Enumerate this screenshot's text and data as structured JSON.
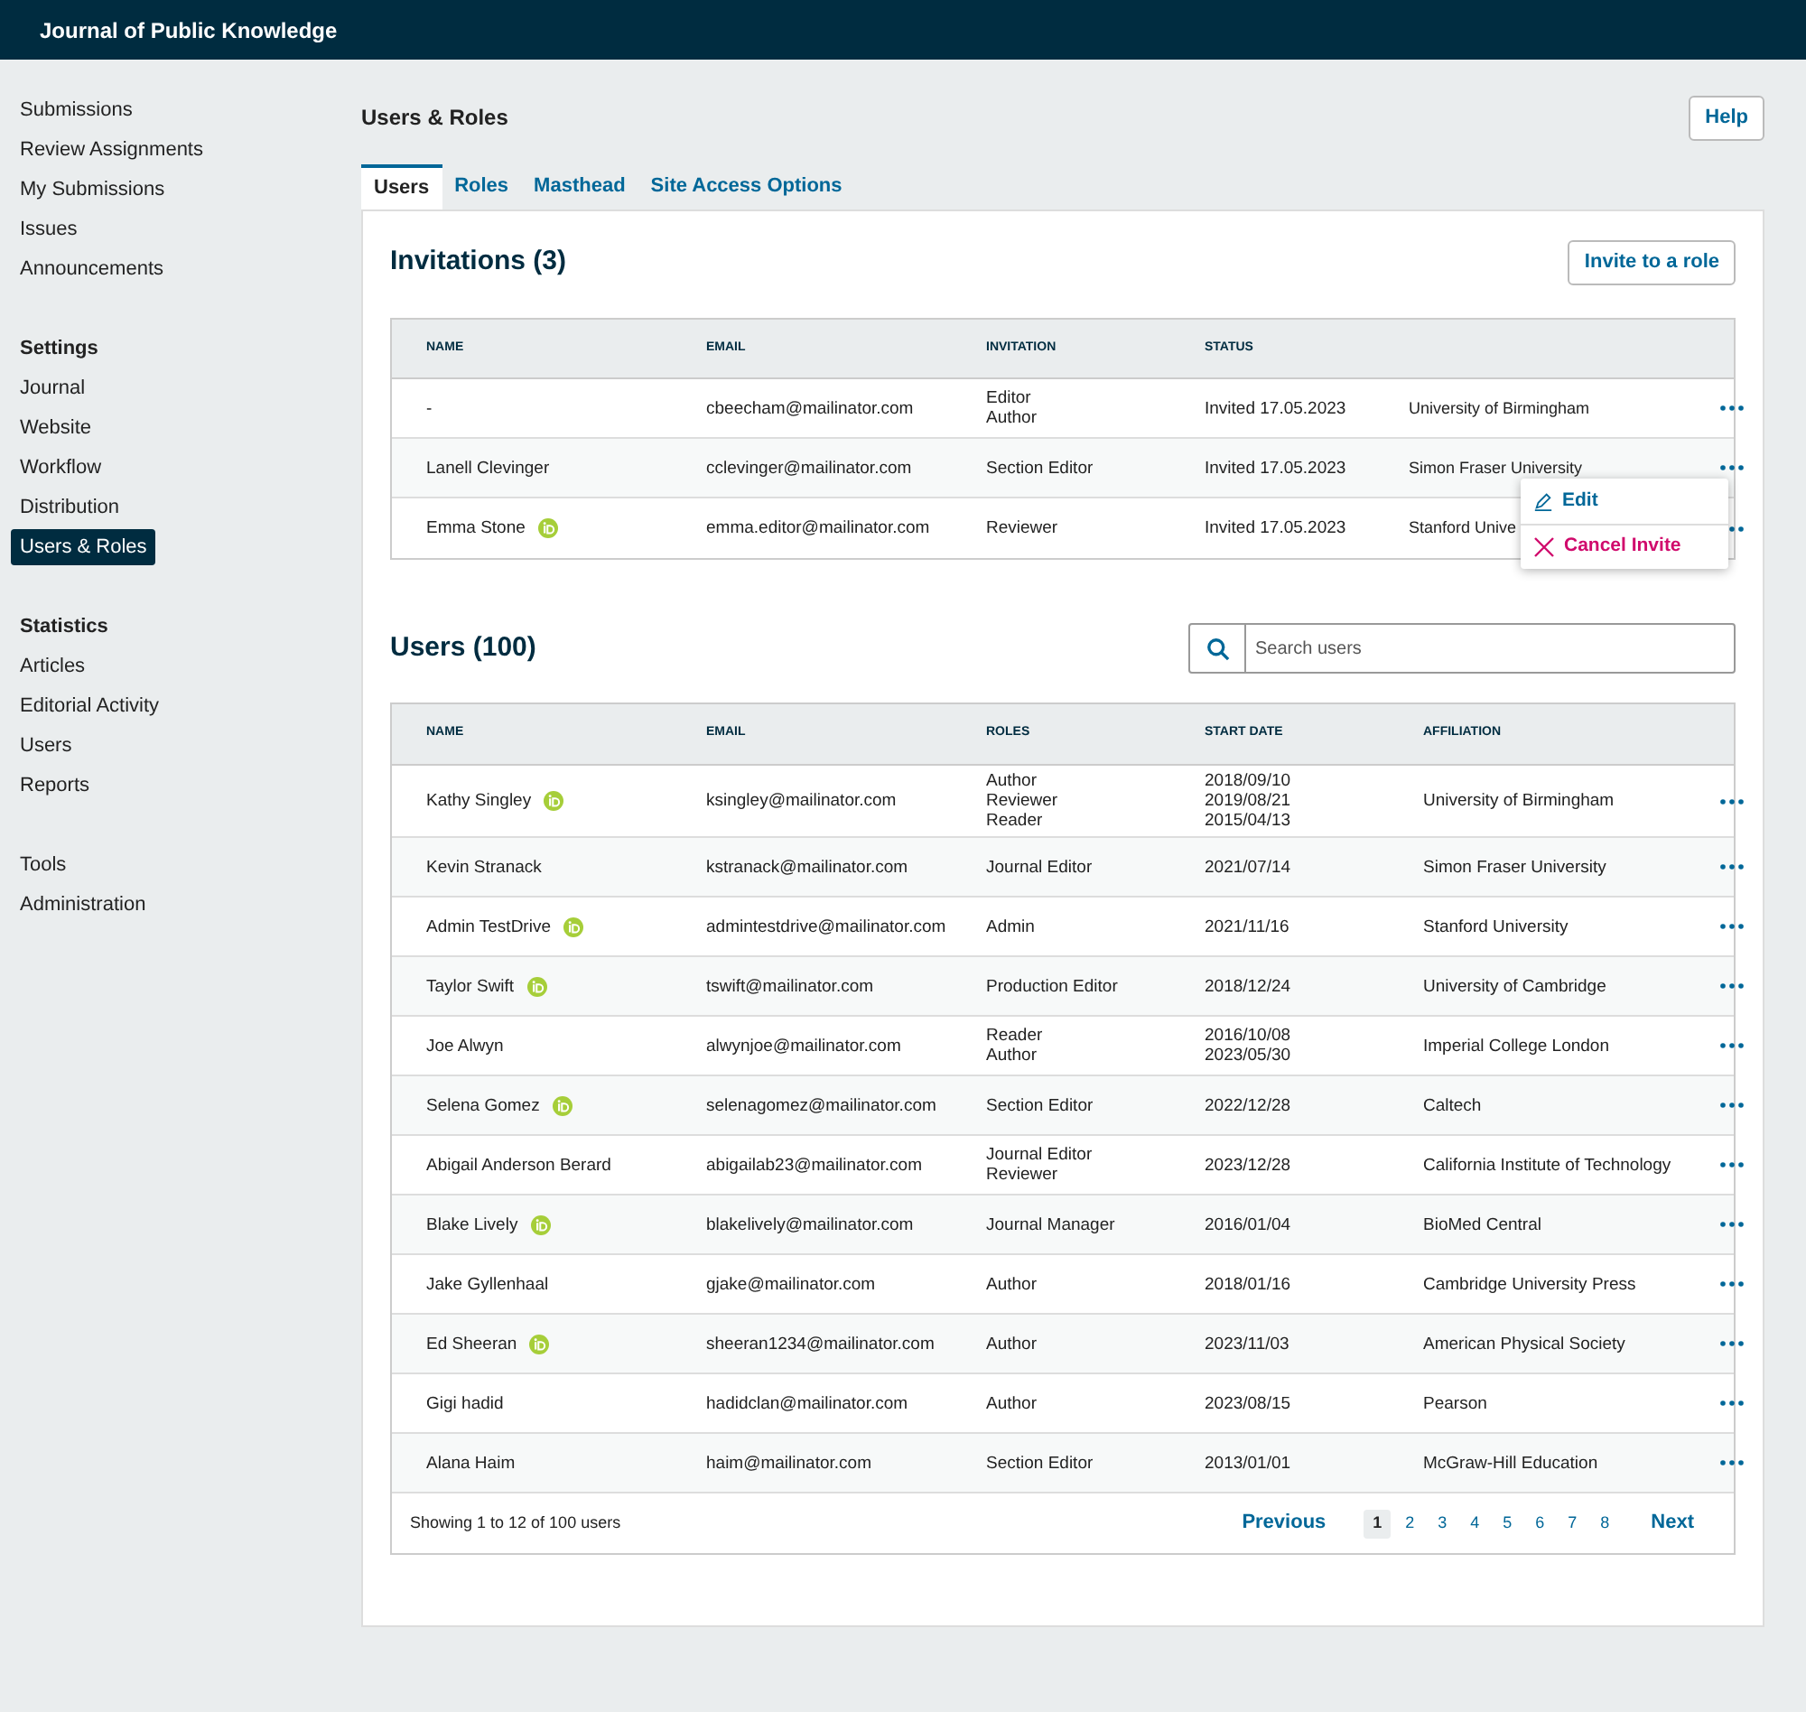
{
  "header": {
    "title": "Journal of Public Knowledge"
  },
  "sidebar": {
    "groups": [
      {
        "items": [
          {
            "label": "Submissions",
            "selected": false
          },
          {
            "label": "Review Assignments",
            "selected": false
          },
          {
            "label": "My Submissions",
            "selected": false
          },
          {
            "label": "Issues",
            "selected": false
          },
          {
            "label": "Announcements",
            "selected": false
          }
        ]
      },
      {
        "heading": "Settings",
        "items": [
          {
            "label": "Journal",
            "selected": false
          },
          {
            "label": "Website",
            "selected": false
          },
          {
            "label": "Workflow",
            "selected": false
          },
          {
            "label": "Distribution",
            "selected": false
          },
          {
            "label": "Users & Roles",
            "selected": true
          }
        ]
      },
      {
        "heading": "Statistics",
        "items": [
          {
            "label": "Articles",
            "selected": false
          },
          {
            "label": "Editorial Activity",
            "selected": false
          },
          {
            "label": "Users",
            "selected": false
          },
          {
            "label": "Reports",
            "selected": false
          }
        ]
      },
      {
        "items": [
          {
            "label": "Tools",
            "selected": false
          },
          {
            "label": "Administration",
            "selected": false
          }
        ]
      }
    ]
  },
  "page": {
    "title": "Users & Roles",
    "help_button": "Help"
  },
  "tabs": [
    {
      "label": "Users",
      "selected": true
    },
    {
      "label": "Roles",
      "selected": false
    },
    {
      "label": "Masthead",
      "selected": false
    },
    {
      "label": "Site Access Options",
      "selected": false
    }
  ],
  "invitations": {
    "title": "Invitations (3)",
    "button": "Invite to a role",
    "columns": [
      "NAME",
      "EMAIL",
      "INVITATION",
      "STATUS"
    ],
    "rows": [
      {
        "name": "-",
        "orcid": false,
        "email": "cbeecham@mailinator.com",
        "roles": [
          "Editor",
          "Author"
        ],
        "status": "Invited 17.05.2023",
        "affiliation": "University of Birmingham"
      },
      {
        "name": "Lanell Clevinger",
        "orcid": false,
        "email": "cclevinger@mailinator.com",
        "roles": [
          "Section Editor"
        ],
        "status": "Invited 17.05.2023",
        "affiliation": "Simon Fraser University"
      },
      {
        "name": "Emma Stone",
        "orcid": true,
        "email": "emma.editor@mailinator.com",
        "roles": [
          "Reviewer"
        ],
        "status": "Invited 17.05.2023",
        "affiliation": "Stanford Unive"
      }
    ],
    "menu": [
      {
        "kind": "edit",
        "label": "Edit"
      },
      {
        "kind": "cancel",
        "label": "Cancel Invite"
      }
    ]
  },
  "users": {
    "title": "Users (100)",
    "search": {
      "placeholder": "Search users"
    },
    "columns": [
      "NAME",
      "EMAIL",
      "ROLES",
      "START DATE",
      "AFFILIATION"
    ],
    "rows": [
      {
        "name": "Kathy Singley",
        "orcid": true,
        "email": "ksingley@mailinator.com",
        "roles": [
          "Author",
          "Reviewer",
          "Reader"
        ],
        "dates": [
          "2018/09/10",
          "2019/08/21",
          "2015/04/13"
        ],
        "affiliation": "University of Birmingham"
      },
      {
        "name": "Kevin Stranack",
        "orcid": false,
        "email": "kstranack@mailinator.com",
        "roles": [
          "Journal Editor"
        ],
        "dates": [
          "2021/07/14"
        ],
        "affiliation": "Simon Fraser University"
      },
      {
        "name": "Admin TestDrive",
        "orcid": true,
        "email": "admintestdrive@mailinator.com",
        "roles": [
          "Admin"
        ],
        "dates": [
          "2021/11/16"
        ],
        "affiliation": "Stanford University"
      },
      {
        "name": "Taylor Swift",
        "orcid": true,
        "email": "tswift@mailinator.com",
        "roles": [
          "Production Editor"
        ],
        "dates": [
          "2018/12/24"
        ],
        "affiliation": "University of Cambridge"
      },
      {
        "name": "Joe Alwyn",
        "orcid": false,
        "email": "alwynjoe@mailinator.com",
        "roles": [
          "Reader",
          "Author"
        ],
        "dates": [
          "2016/10/08",
          "2023/05/30"
        ],
        "affiliation": "Imperial College London"
      },
      {
        "name": "Selena Gomez",
        "orcid": true,
        "email": "selenagomez@mailinator.com",
        "roles": [
          "Section Editor"
        ],
        "dates": [
          "2022/12/28"
        ],
        "affiliation": "Caltech"
      },
      {
        "name": "Abigail Anderson Berard",
        "orcid": false,
        "email": "abigailab23@mailinator.com",
        "roles": [
          "Journal Editor",
          "Reviewer"
        ],
        "dates": [
          "2023/12/28"
        ],
        "affiliation": "California Institute of Technology"
      },
      {
        "name": "Blake Lively",
        "orcid": true,
        "email": "blakelively@mailinator.com",
        "roles": [
          "Journal Manager"
        ],
        "dates": [
          "2016/01/04"
        ],
        "affiliation": "BioMed Central"
      },
      {
        "name": "Jake Gyllenhaal",
        "orcid": false,
        "email": "gjake@mailinator.com",
        "roles": [
          "Author"
        ],
        "dates": [
          "2018/01/16"
        ],
        "affiliation": "Cambridge University Press"
      },
      {
        "name": "Ed Sheeran",
        "orcid": true,
        "email": "sheeran1234@mailinator.com",
        "roles": [
          "Author"
        ],
        "dates": [
          "2023/11/03"
        ],
        "affiliation": "American Physical Society"
      },
      {
        "name": "Gigi hadid",
        "orcid": false,
        "email": "hadidclan@mailinator.com",
        "roles": [
          "Author"
        ],
        "dates": [
          "2023/08/15"
        ],
        "affiliation": "Pearson"
      },
      {
        "name": "Alana Haim",
        "orcid": false,
        "email": "haim@mailinator.com",
        "roles": [
          "Section Editor"
        ],
        "dates": [
          "2013/01/01"
        ],
        "affiliation": "McGraw-Hill Education"
      }
    ],
    "footer": {
      "showing": "Showing 1 to 12 of 100 users",
      "previous": "Previous",
      "next": "Next",
      "pages": [
        {
          "label": "1",
          "selected": true
        },
        {
          "label": "2",
          "selected": false
        },
        {
          "label": "3",
          "selected": false
        },
        {
          "label": "4",
          "selected": false
        },
        {
          "label": "5",
          "selected": false
        },
        {
          "label": "6",
          "selected": false
        },
        {
          "label": "7",
          "selected": false
        },
        {
          "label": "8",
          "selected": false
        }
      ]
    }
  }
}
